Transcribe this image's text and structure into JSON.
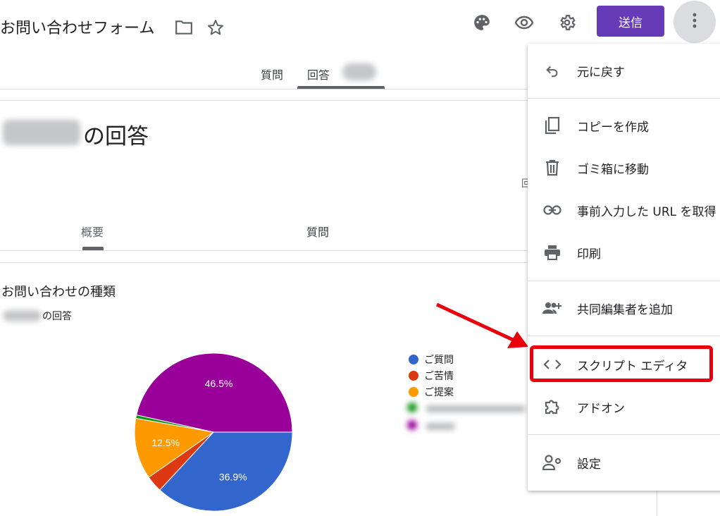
{
  "header": {
    "title": "お問い合わせフォーム",
    "send_label": "送信"
  },
  "tabs": {
    "questions": "質問",
    "responses": "回答"
  },
  "responses": {
    "heading_suffix": "の回答",
    "subtab_summary": "概要",
    "subtab_question": "質問",
    "right_edge_char": "回"
  },
  "question_card": {
    "title": "お問い合わせの種類",
    "count_suffix": "の回答"
  },
  "chart_data": {
    "type": "pie",
    "title": "お問い合わせの種類",
    "slices": [
      {
        "label": "ご質問",
        "value": 36.9,
        "color": "#3366cc",
        "label_text": "36.9%"
      },
      {
        "label": "ご苦情",
        "value": 3.4,
        "color": "#dc3912",
        "label_text": ""
      },
      {
        "label": "ご提案",
        "value": 12.5,
        "color": "#ff9900",
        "label_text": "12.5%"
      },
      {
        "label": "",
        "value": 0.7,
        "color": "#109618",
        "label_text": ""
      },
      {
        "label": "",
        "value": 46.5,
        "color": "#990099",
        "label_text": "46.5%"
      }
    ],
    "legend": [
      "ご質問",
      "ご苦情",
      "ご提案"
    ]
  },
  "menu": {
    "undo": "元に戻す",
    "copy": "コピーを作成",
    "trash": "ゴミ箱に移動",
    "prefill": "事前入力した URL を取得",
    "print": "印刷",
    "collaborators": "共同編集者を追加",
    "script_editor": "スクリプト エディタ",
    "addons": "アドオン",
    "settings": "設定"
  },
  "annotation": {
    "highlight_color": "#e8000b"
  }
}
